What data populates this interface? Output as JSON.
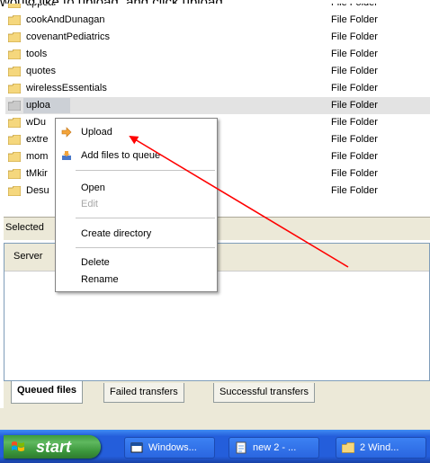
{
  "caption": "would like to upload, and click upload",
  "files": [
    {
      "name": "appeal",
      "type": "File Folder"
    },
    {
      "name": "cookAndDunagan",
      "type": "File Folder"
    },
    {
      "name": "covenantPediatrics",
      "type": "File Folder"
    },
    {
      "name": "tools",
      "type": "File Folder"
    },
    {
      "name": "quotes",
      "type": "File Folder"
    },
    {
      "name": "wirelessEssentials",
      "type": "File Folder"
    },
    {
      "name": "uploa",
      "type": "File Folder"
    },
    {
      "name": "wDu",
      "type": "File Folder"
    },
    {
      "name": "extre",
      "type": "File Folder"
    },
    {
      "name": "mom",
      "type": "File Folder"
    },
    {
      "name": "tMkir",
      "type": "File Folder"
    },
    {
      "name": "Desu",
      "type": "File Folder"
    }
  ],
  "status": {
    "selected_label": "Selected"
  },
  "queue": {
    "server_column": "Server"
  },
  "context_menu": {
    "items": [
      {
        "label": "Upload",
        "icon": "upload-arrow-icon"
      },
      {
        "label": "Add files to queue",
        "icon": "add-to-queue-icon"
      },
      {
        "label": "Open"
      },
      {
        "label": "Edit"
      },
      {
        "label": "Create directory"
      },
      {
        "label": "Delete"
      },
      {
        "label": "Rename"
      }
    ]
  },
  "tabs": [
    {
      "label": "Queued files"
    },
    {
      "label": "Failed transfers"
    },
    {
      "label": "Successful transfers"
    }
  ],
  "taskbar": {
    "start_label": "start",
    "tasks": [
      {
        "label": "Windows...",
        "icon": "window-icon"
      },
      {
        "label": "new 2 - ...",
        "icon": "notepad-icon"
      },
      {
        "label": "2 Wind...",
        "icon": "folder-icon"
      }
    ]
  },
  "colors": {
    "annotation_arrow": "#ff0000",
    "folder": "#f5d77d"
  }
}
